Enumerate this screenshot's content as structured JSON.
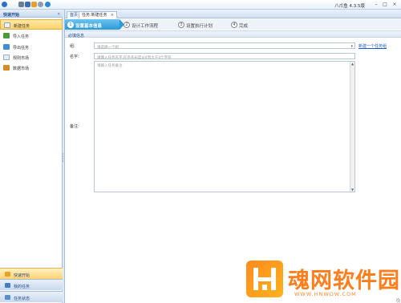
{
  "titlebar": {
    "app_title": "八爪鱼 4.3.5版",
    "icons": [
      "app-logo-icon",
      "user-icon",
      "save-icon",
      "pencil-icon",
      "info-icon",
      "help-icon"
    ],
    "window_controls": [
      "–",
      "□",
      "×"
    ]
  },
  "sidebar": {
    "header": "快速开始",
    "collapse_glyph": "«",
    "items": [
      {
        "label": "新建任务",
        "icon": "new-task-icon",
        "active": true
      },
      {
        "label": "导入任务",
        "icon": "import-icon",
        "active": false
      },
      {
        "label": "导出任务",
        "icon": "export-icon",
        "active": false
      },
      {
        "label": "规则市场",
        "icon": "rule-market-icon",
        "active": false
      },
      {
        "label": "数据市场",
        "icon": "data-market-icon",
        "active": false
      }
    ],
    "bottom_tabs": [
      {
        "label": "快速开始",
        "active": true
      },
      {
        "label": "我的任务",
        "active": false
      },
      {
        "label": "任务状态",
        "active": false
      }
    ]
  },
  "tabs": [
    {
      "label": "首页",
      "active": false
    },
    {
      "label": "任务:新建任务",
      "active": true,
      "close": "×"
    }
  ],
  "steps": [
    {
      "num": "1",
      "label": "设置基本信息",
      "active": true
    },
    {
      "num": "2",
      "label": "设计工作流程",
      "active": false
    },
    {
      "num": "3",
      "label": "设置执行计划",
      "active": false
    },
    {
      "num": "4",
      "label": "完成",
      "active": false
    }
  ],
  "form": {
    "section_title": "必填信息",
    "group_label": "组:",
    "group_placeholder": "请选择一个组",
    "group_link": "新建一个任务组",
    "name_label": "名字:",
    "name_placeholder": "请输入任务名字,任务名长度从4到大于4个字符",
    "note_label": "备注:",
    "note_placeholder": "请输入任务备注"
  },
  "watermark": {
    "text": "魂网软件园",
    "url": "WWW.HNWDW.COM"
  },
  "colors": {
    "accent_step": "#2b9ad8",
    "active_sidebar": "#ffd36b",
    "link": "#1a5bbd",
    "watermark": "#ff7d1a"
  }
}
